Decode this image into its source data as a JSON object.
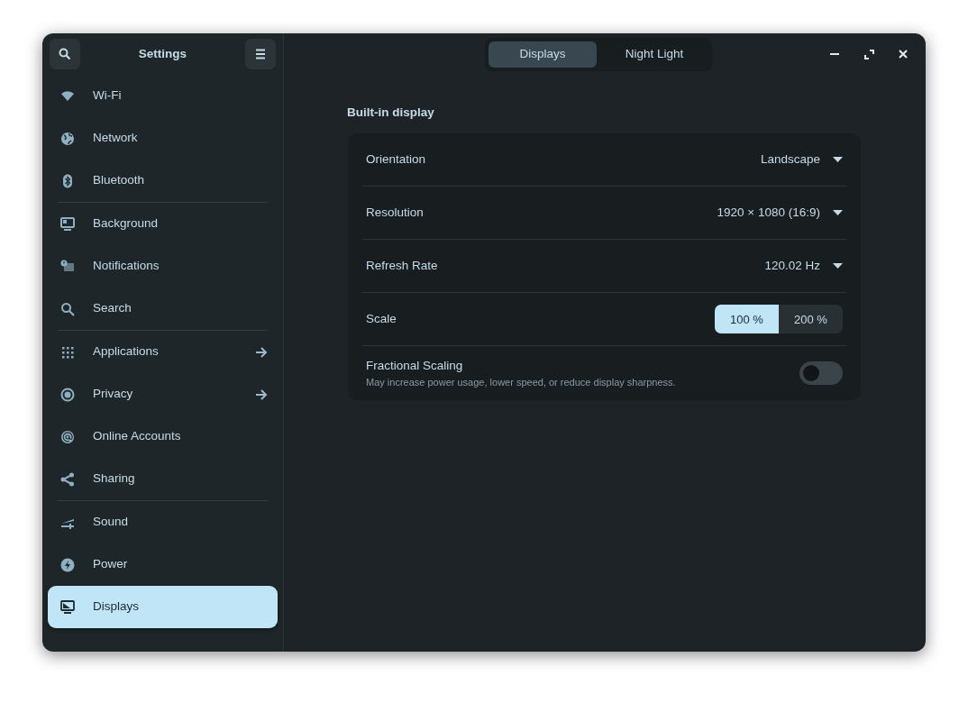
{
  "sidebar": {
    "title": "Settings",
    "groups": [
      [
        {
          "label": "Wi-Fi",
          "selected": false,
          "has_arrow": false
        },
        {
          "label": "Network",
          "selected": false,
          "has_arrow": false
        },
        {
          "label": "Bluetooth",
          "selected": false,
          "has_arrow": false
        }
      ],
      [
        {
          "label": "Background",
          "selected": false,
          "has_arrow": false
        },
        {
          "label": "Notifications",
          "selected": false,
          "has_arrow": false
        },
        {
          "label": "Search",
          "selected": false,
          "has_arrow": false
        }
      ],
      [
        {
          "label": "Applications",
          "selected": false,
          "has_arrow": true
        },
        {
          "label": "Privacy",
          "selected": false,
          "has_arrow": true
        },
        {
          "label": "Online Accounts",
          "selected": false,
          "has_arrow": false
        },
        {
          "label": "Sharing",
          "selected": false,
          "has_arrow": false
        }
      ],
      [
        {
          "label": "Sound",
          "selected": false,
          "has_arrow": false
        },
        {
          "label": "Power",
          "selected": false,
          "has_arrow": false
        },
        {
          "label": "Displays",
          "selected": true,
          "has_arrow": false
        }
      ]
    ]
  },
  "tabs": [
    {
      "label": "Displays",
      "selected": true
    },
    {
      "label": "Night Light",
      "selected": false
    }
  ],
  "section": {
    "title": "Built-in display",
    "rows": [
      {
        "kind": "dropdown",
        "label": "Orientation",
        "value": "Landscape"
      },
      {
        "kind": "dropdown",
        "label": "Resolution",
        "value": "1920 × 1080 (16:9)"
      },
      {
        "kind": "dropdown",
        "label": "Refresh Rate",
        "value": "120.02 Hz"
      },
      {
        "kind": "scale",
        "label": "Scale",
        "options": [
          {
            "label": "100 %",
            "selected": true
          },
          {
            "label": "200 %",
            "selected": false
          }
        ]
      },
      {
        "kind": "switch",
        "label": "Fractional Scaling",
        "subtitle": "May increase power usage, lower speed, or reduce display sharpness.",
        "on": false
      }
    ]
  }
}
